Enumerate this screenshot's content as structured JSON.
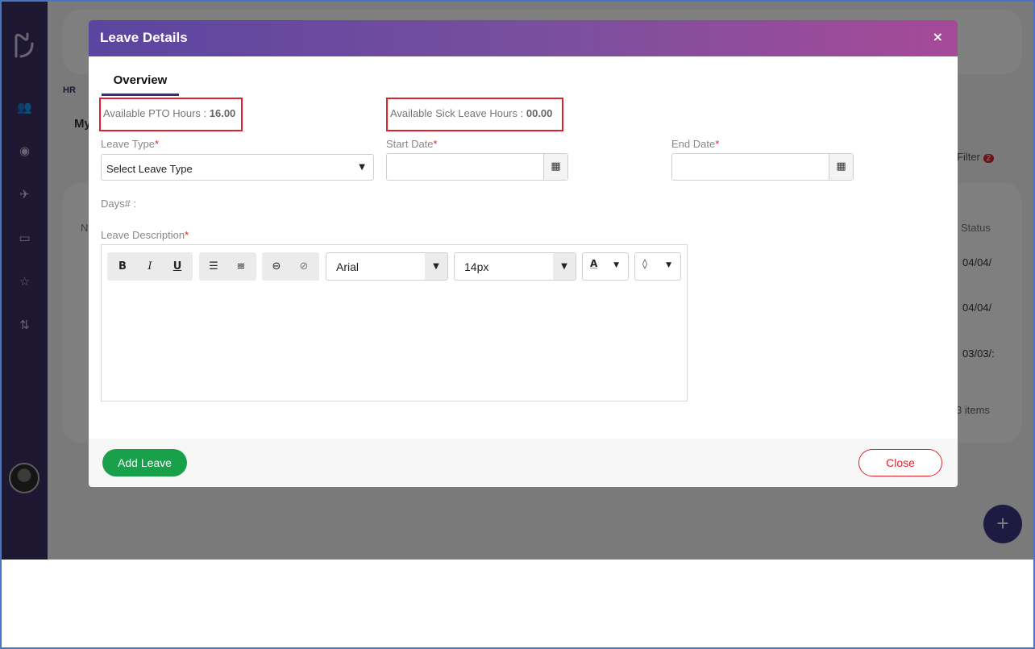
{
  "background": {
    "breadcrumb": "HR",
    "tab_label": "My",
    "filter_label": "Filter",
    "filter_count": "2",
    "col_first": "N",
    "col_status": "Status",
    "rows": [
      "04/04/",
      "04/04/",
      "03/03/:"
    ],
    "items_label": "3 items",
    "fab_label": "+"
  },
  "modal": {
    "title": "Leave Details",
    "close_icon": "×",
    "tab_overview": "Overview",
    "pto_label": "Available PTO Hours : ",
    "pto_value": "16.00",
    "sick_label": "Available Sick Leave Hours : ",
    "sick_value": "00.00",
    "leave_type_label": "Leave Type",
    "leave_type_value": "Select Leave Type",
    "start_date_label": "Start Date",
    "end_date_label": "End Date",
    "days_label": "Days# :",
    "description_label": "Leave Description",
    "required_mark": "*",
    "editor": {
      "bold": "B",
      "italic": "I",
      "underline": "U",
      "font_family": "Arial",
      "font_size": "14px",
      "font_color_label": "A"
    },
    "add_button": "Add Leave",
    "close_button": "Close"
  },
  "colors": {
    "sidebar": "#3a2e63",
    "header_start": "#5a45a0",
    "header_end": "#a64a98",
    "add_button": "#19a04b",
    "danger": "#e0222e"
  }
}
